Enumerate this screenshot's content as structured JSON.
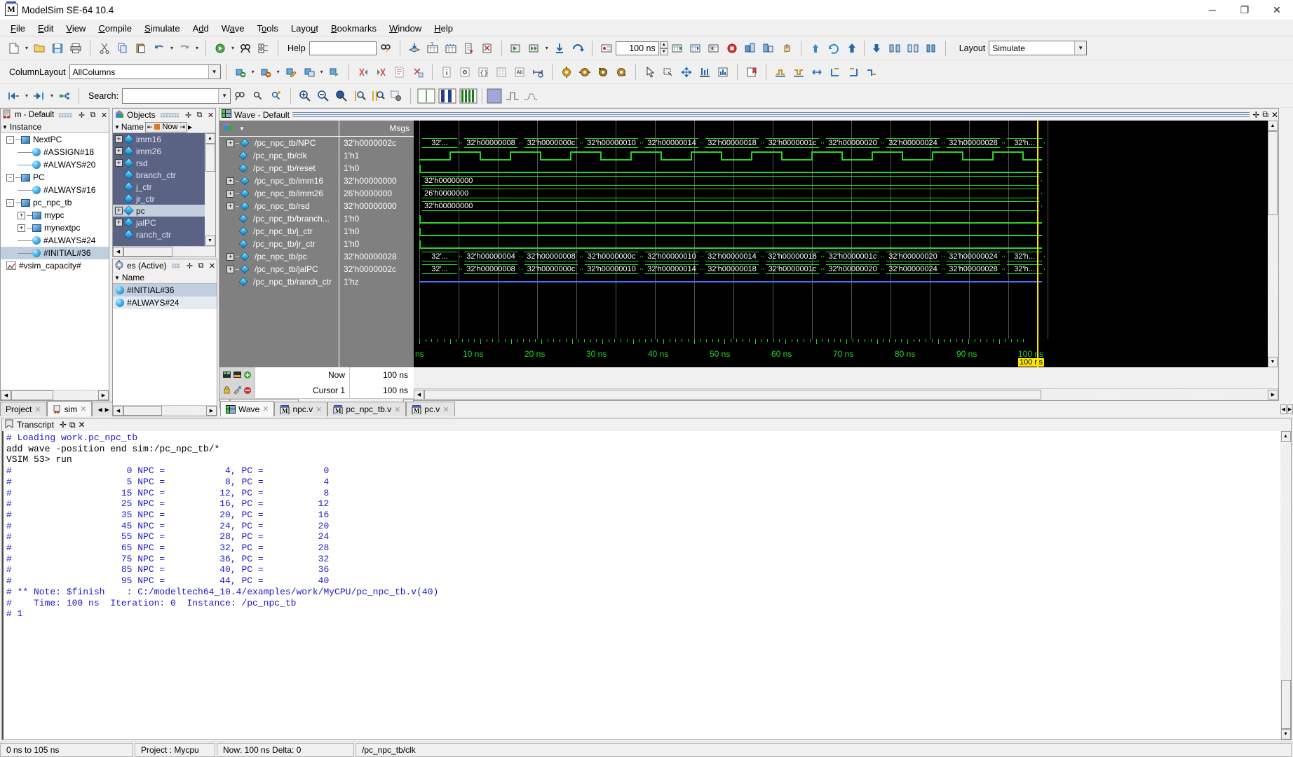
{
  "window": {
    "title": "ModelSim SE-64 10.4",
    "minimize": "─",
    "maximize": "❐",
    "close": "✕",
    "app_icon": "M"
  },
  "menubar": [
    {
      "label": "File",
      "mnemonic": "F"
    },
    {
      "label": "Edit",
      "mnemonic": "E"
    },
    {
      "label": "View",
      "mnemonic": "V"
    },
    {
      "label": "Compile",
      "mnemonic": "C"
    },
    {
      "label": "Simulate",
      "mnemonic": "S"
    },
    {
      "label": "Add",
      "mnemonic": "d"
    },
    {
      "label": "Wave",
      "mnemonic": "a"
    },
    {
      "label": "Tools",
      "mnemonic": "o"
    },
    {
      "label": "Layout",
      "mnemonic": "u"
    },
    {
      "label": "Bookmarks",
      "mnemonic": "B"
    },
    {
      "label": "Window",
      "mnemonic": "W"
    },
    {
      "label": "Help",
      "mnemonic": "H"
    }
  ],
  "toolbar1": {
    "help_label": "Help",
    "help_value": "",
    "run_length": "100 ns",
    "layout_label": "Layout",
    "layout_value": "Simulate"
  },
  "toolbar2": {
    "columnlayout_label": "ColumnLayout",
    "columnlayout_value": "AllColumns"
  },
  "toolbar3": {
    "search_label": "Search:",
    "search_value": ""
  },
  "sim_panel": {
    "title": "m - Default",
    "column_header": "Instance",
    "rows": [
      {
        "label": "NextPC",
        "depth": 0,
        "type": "module",
        "expander": "-"
      },
      {
        "label": "#ASSIGN#18",
        "depth": 1,
        "type": "process",
        "expander": ""
      },
      {
        "label": "#ALWAYS#20",
        "depth": 1,
        "type": "process",
        "expander": ""
      },
      {
        "label": "PC",
        "depth": 0,
        "type": "module",
        "expander": "-"
      },
      {
        "label": "#ALWAYS#16",
        "depth": 1,
        "type": "process",
        "expander": ""
      },
      {
        "label": "pc_npc_tb",
        "depth": 0,
        "type": "module",
        "expander": "-"
      },
      {
        "label": "mypc",
        "depth": 1,
        "type": "module",
        "expander": "+"
      },
      {
        "label": "mynextpc",
        "depth": 1,
        "type": "module",
        "expander": "+"
      },
      {
        "label": "#ALWAYS#24",
        "depth": 1,
        "type": "process",
        "expander": ""
      },
      {
        "label": "#INITIAL#36",
        "depth": 1,
        "type": "process",
        "expander": "",
        "selected": true
      },
      {
        "label": "#vsim_capacity#",
        "depth": 0,
        "type": "capacity",
        "expander": ""
      }
    ],
    "tabs": [
      {
        "label": "Project",
        "active": false
      },
      {
        "label": "sim",
        "active": true
      }
    ]
  },
  "objects_panel": {
    "title": "Objects",
    "column_header": "Name",
    "now_label": "Now",
    "rows": [
      {
        "label": "imm16",
        "expandable": true
      },
      {
        "label": "imm26",
        "expandable": true
      },
      {
        "label": "rsd",
        "expandable": true
      },
      {
        "label": "branch_ctr",
        "expandable": false
      },
      {
        "label": "j_ctr",
        "expandable": false
      },
      {
        "label": "jr_ctr",
        "expandable": false
      },
      {
        "label": "pc",
        "expandable": true,
        "selected": true
      },
      {
        "label": "jalPC",
        "expandable": true
      },
      {
        "label": "ranch_ctr",
        "expandable": false
      }
    ]
  },
  "processes_panel": {
    "title": "es (Active)",
    "column_header": "Name",
    "rows": [
      {
        "label": "#INITIAL#36",
        "selected": true
      },
      {
        "label": "#ALWAYS#24",
        "selected": false
      }
    ]
  },
  "wave": {
    "title": "Wave - Default",
    "msgs_header": "Msgs",
    "signals": [
      {
        "name": "/pc_npc_tb/NPC",
        "value": "32'h0000002c",
        "expandable": true,
        "kind": "bus",
        "pattern": "npc"
      },
      {
        "name": "/pc_npc_tb/clk",
        "value": "1'h1",
        "expandable": false,
        "kind": "clock"
      },
      {
        "name": "/pc_npc_tb/reset",
        "value": "1'h0",
        "expandable": false,
        "kind": "low"
      },
      {
        "name": "/pc_npc_tb/imm16",
        "value": "32'h00000000",
        "expandable": true,
        "kind": "const",
        "const_label": "32'h00000000"
      },
      {
        "name": "/pc_npc_tb/imm26",
        "value": "26'h0000000",
        "expandable": true,
        "kind": "const",
        "const_label": "26'h0000000"
      },
      {
        "name": "/pc_npc_tb/rsd",
        "value": "32'h00000000",
        "expandable": true,
        "kind": "const",
        "const_label": "32'h00000000"
      },
      {
        "name": "/pc_npc_tb/branch...",
        "value": "1'h0",
        "expandable": false,
        "kind": "low"
      },
      {
        "name": "/pc_npc_tb/j_ctr",
        "value": "1'h0",
        "expandable": false,
        "kind": "low"
      },
      {
        "name": "/pc_npc_tb/jr_ctr",
        "value": "1'h0",
        "expandable": false,
        "kind": "low"
      },
      {
        "name": "/pc_npc_tb/pc",
        "value": "32'h00000028",
        "expandable": true,
        "kind": "bus",
        "pattern": "pc",
        "selected": true
      },
      {
        "name": "/pc_npc_tb/jalPC",
        "value": "32'h0000002c",
        "expandable": true,
        "kind": "bus",
        "pattern": "npc"
      },
      {
        "name": "/pc_npc_tb/ranch_ctr",
        "value": "1'hz",
        "expandable": false,
        "kind": "z"
      }
    ],
    "bus_values_npc": [
      "32'...",
      "32'h00000008",
      "32'h0000000c",
      "32'h00000010",
      "32'h00000014",
      "32'h00000018",
      "32'h0000001c",
      "32'h00000020",
      "32'h00000024",
      "32'h00000028",
      "32'h..."
    ],
    "bus_values_pc": [
      "32'...",
      "32'h00000004",
      "32'h00000008",
      "32'h0000000c",
      "32'h00000010",
      "32'h00000014",
      "32'h00000018",
      "32'h0000001c",
      "32'h00000020",
      "32'h00000024",
      "32'h..."
    ],
    "timeline_labels": [
      "ns",
      "10 ns",
      "20 ns",
      "30 ns",
      "40 ns",
      "50 ns",
      "60 ns",
      "70 ns",
      "80 ns",
      "90 ns",
      "100 ns"
    ],
    "cursor_flag": "100 ns",
    "now_label": "Now",
    "now_value": "100 ns",
    "cursor_label": "Cursor 1",
    "cursor_value": "100 ns",
    "tabs": [
      {
        "label": "Wave",
        "active": true,
        "icon": "wave-icon"
      },
      {
        "label": "npc.v",
        "active": false,
        "icon": "modelsim-file-icon"
      },
      {
        "label": "pc_npc_tb.v",
        "active": false,
        "icon": "modelsim-file-icon"
      },
      {
        "label": "pc.v",
        "active": false,
        "icon": "modelsim-file-icon"
      }
    ]
  },
  "transcript": {
    "title": "Transcript",
    "lines": [
      {
        "text": "# Loading work.pc_npc_tb",
        "style": "msg"
      },
      {
        "text": "add wave -position end sim:/pc_npc_tb/*",
        "style": "cmd"
      },
      {
        "text": "VSIM 53> run",
        "style": "cmd"
      },
      {
        "text": "#                     0 NPC =           4, PC =           0",
        "style": "msg"
      },
      {
        "text": "#                     5 NPC =           8, PC =           4",
        "style": "msg"
      },
      {
        "text": "#                    15 NPC =          12, PC =           8",
        "style": "msg"
      },
      {
        "text": "#                    25 NPC =          16, PC =          12",
        "style": "msg"
      },
      {
        "text": "#                    35 NPC =          20, PC =          16",
        "style": "msg"
      },
      {
        "text": "#                    45 NPC =          24, PC =          20",
        "style": "msg"
      },
      {
        "text": "#                    55 NPC =          28, PC =          24",
        "style": "msg"
      },
      {
        "text": "#                    65 NPC =          32, PC =          28",
        "style": "msg"
      },
      {
        "text": "#                    75 NPC =          36, PC =          32",
        "style": "msg"
      },
      {
        "text": "#                    85 NPC =          40, PC =          36",
        "style": "msg"
      },
      {
        "text": "#                    95 NPC =          44, PC =          40",
        "style": "msg"
      },
      {
        "text": "# ** Note: $finish    : C:/modeltech64_10.4/examples/work/MyCPU/pc_npc_tb.v(40)",
        "style": "msg"
      },
      {
        "text": "#    Time: 100 ns  Iteration: 0  Instance: /pc_npc_tb",
        "style": "msg"
      },
      {
        "text": "# 1",
        "style": "msg"
      }
    ]
  },
  "statusbar": {
    "range": "0 ns to 105 ns",
    "project": "Project : Mycpu",
    "now": "Now: 100 ns  Delta: 0",
    "signal": "/pc_npc_tb/clk"
  },
  "colors": {
    "wave_green": "#27d427",
    "wave_blue": "#4a6fff",
    "cursor_yellow": "#ffe400",
    "objects_bg": "#5b6384",
    "panel_gray": "#808080"
  }
}
